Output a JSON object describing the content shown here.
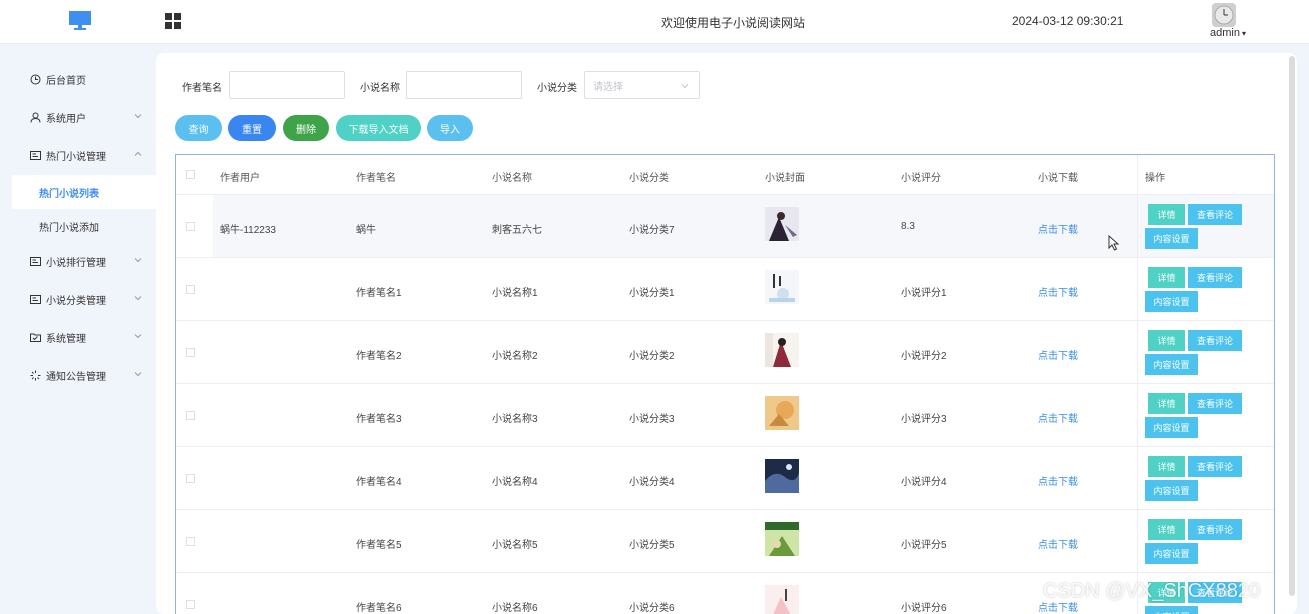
{
  "header": {
    "site_title": "欢迎使用电子小说阅读网站",
    "datetime": "2024-03-12 09:30:21",
    "username": "admin",
    "username_caret": "▾"
  },
  "sidebar": {
    "items": [
      {
        "label": "后台首页",
        "icon": "clock-icon"
      },
      {
        "label": "系统用户",
        "icon": "user-icon"
      },
      {
        "label": "热门小说管理",
        "icon": "list-icon"
      },
      {
        "label": "小说排行管理",
        "icon": "list-icon"
      },
      {
        "label": "小说分类管理",
        "icon": "list-icon"
      },
      {
        "label": "系统管理",
        "icon": "folder-icon"
      },
      {
        "label": "通知公告管理",
        "icon": "loading-icon"
      }
    ],
    "sub_items": [
      {
        "label": "热门小说列表",
        "active": true
      },
      {
        "label": "热门小说添加",
        "active": false
      }
    ]
  },
  "filters": {
    "author_pen_label": "作者笔名",
    "author_pen_value": "",
    "novel_name_label": "小说名称",
    "novel_name_value": "",
    "category_label": "小说分类",
    "category_placeholder": "请选择"
  },
  "toolbar": {
    "query": "查询",
    "reset": "重置",
    "delete": "删除",
    "download_template": "下载导入文档",
    "import": "导入"
  },
  "table": {
    "columns": [
      "作者用户",
      "作者笔名",
      "小说名称",
      "小说分类",
      "小说封面",
      "小说评分",
      "小说下载",
      "操作"
    ],
    "rows": [
      {
        "author_user": "蜗牛-112233",
        "pen_name": "蜗牛",
        "novel_name": "刺客五六七",
        "category": "小说分类7",
        "rating": "8.3",
        "download": "点击下载"
      },
      {
        "author_user": "",
        "pen_name": "作者笔名1",
        "novel_name": "小说名称1",
        "category": "小说分类1",
        "rating": "小说评分1",
        "download": "点击下载"
      },
      {
        "author_user": "",
        "pen_name": "作者笔名2",
        "novel_name": "小说名称2",
        "category": "小说分类2",
        "rating": "小说评分2",
        "download": "点击下载"
      },
      {
        "author_user": "",
        "pen_name": "作者笔名3",
        "novel_name": "小说名称3",
        "category": "小说分类3",
        "rating": "小说评分3",
        "download": "点击下载"
      },
      {
        "author_user": "",
        "pen_name": "作者笔名4",
        "novel_name": "小说名称4",
        "category": "小说分类4",
        "rating": "小说评分4",
        "download": "点击下载"
      },
      {
        "author_user": "",
        "pen_name": "作者笔名5",
        "novel_name": "小说名称5",
        "category": "小说分类5",
        "rating": "小说评分5",
        "download": "点击下载"
      },
      {
        "author_user": "",
        "pen_name": "作者笔名6",
        "novel_name": "小说名称6",
        "category": "小说分类6",
        "rating": "小说评分6",
        "download": "点击下载"
      }
    ],
    "actions": {
      "detail": "详情",
      "comments": "查看评论",
      "content": "内容设置"
    }
  },
  "watermark": "CSDN @VX_ShCX8820",
  "colors": {
    "primary": "#3f8ff0",
    "query_btn": "#5bc0f0",
    "reset_btn": "#3a86f0",
    "delete_btn": "#3fa34a",
    "download_btn": "#4fd1c5",
    "import_btn": "#5bc0f0"
  }
}
